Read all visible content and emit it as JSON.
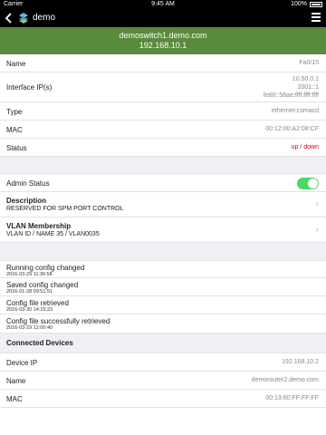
{
  "status_bar": {
    "carrier": "Carrier",
    "time": "9:45 AM",
    "battery": "100%"
  },
  "nav": {
    "title": "demo"
  },
  "header": {
    "hostname": "demoswitch1.demo.com",
    "ip": "192.168.10.1"
  },
  "details": {
    "name": {
      "label": "Name",
      "value": "Fa0/15"
    },
    "interface_ip": {
      "label": "Interface IP(s)",
      "values": [
        "10.50.0.1",
        "2001::1",
        "fe80::58ae:ffff:ffff:ffff"
      ]
    },
    "type": {
      "label": "Type",
      "value": "ethernet-csmacd"
    },
    "mac": {
      "label": "MAC",
      "value": "00:12:00:A2:08:CF"
    },
    "status": {
      "label": "Status",
      "value": "up / down",
      "color": "#d0021b"
    }
  },
  "admin": {
    "label": "Admin Status",
    "enabled": true,
    "toggle_color": "#4cd964"
  },
  "description": {
    "label": "Description",
    "value": "RESERVED FOR SPM PORT CONTROL"
  },
  "vlan": {
    "label": "VLAN Membership",
    "value": "VLAN ID / NAME  35 / VLAN0035"
  },
  "events": [
    {
      "title": "Running config changed",
      "time": "2016-03-29 11:36:58"
    },
    {
      "title": "Saved config changed",
      "time": "2016-01-28 09:51:51"
    },
    {
      "title": "Config file retrieved",
      "time": "2016-03-30 14:15:23"
    },
    {
      "title": "Config file successfully retrieved",
      "time": "2016-03-29 12:00:40"
    }
  ],
  "connected": {
    "heading": "Connected Devices",
    "device_ip": {
      "label": "Device IP",
      "value": "192.168.10.2"
    },
    "name": {
      "label": "Name",
      "value": "demorouter2.demo.com"
    },
    "mac": {
      "label": "MAC",
      "value": "00:13:60:FF:FF:FF"
    }
  },
  "colors": {
    "accent": "#5a8a3c",
    "status_down": "#d0021b"
  }
}
